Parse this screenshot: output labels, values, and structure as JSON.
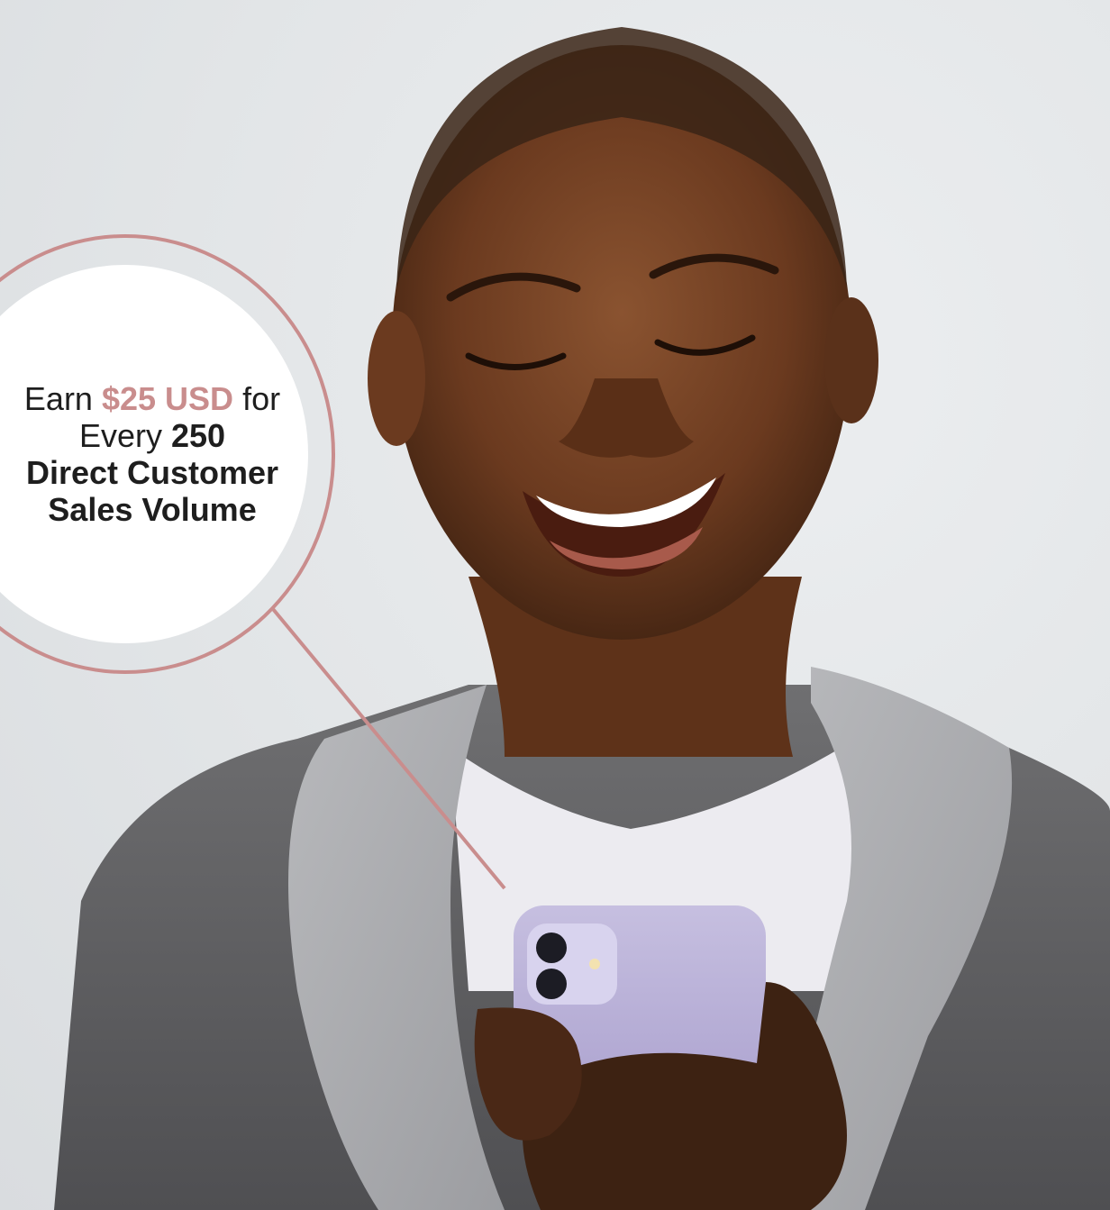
{
  "callout": {
    "line1_prefix": "Earn",
    "amount": "$25 USD",
    "line1_suffix": "for",
    "line2_prefix": "Every",
    "volume_number": "250",
    "line3": "Direct Customer",
    "line4": "Sales Volume"
  },
  "colors": {
    "accent": "#c98d8d",
    "background": "#e4e7e9",
    "text": "#1e1e1e"
  },
  "icons": [
    "phone-icon"
  ]
}
